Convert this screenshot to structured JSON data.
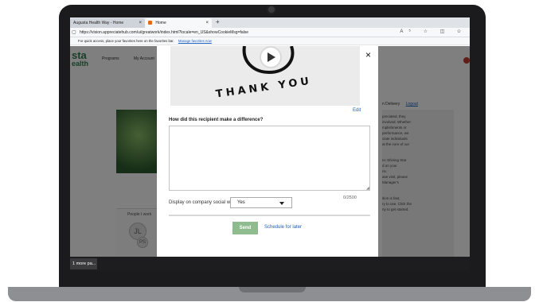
{
  "browser": {
    "tabs": [
      {
        "label": "Augusta Health Way - Home",
        "close": "×"
      },
      {
        "label": "Home",
        "close": "×"
      }
    ],
    "new_tab": "+",
    "url": "https://vision.appreciatehub.com/ui/greatwork/index.html?locale=en_US&showCookieMsg=false",
    "favorites_msg": "For quick access, place your favorites here on the favorites bar.",
    "favorites_link": "Manage favorites now",
    "tool_icons": [
      "read-aloud-icon",
      "favorite-star-icon",
      "split-screen-icon",
      "collections-icon"
    ],
    "tool_glyphs": "A⁵ ☆ ◫ ✩"
  },
  "page": {
    "brand_line1": "sta",
    "brand_line2": "ealth",
    "nav": [
      "Programs",
      "My Account"
    ],
    "right_link_prefix": "n Delivery",
    "right_link": "Logout",
    "right_text": [
      "preciated, they",
      "involved. Whether",
      "mplishments or",
      "performance, we",
      "ciate individuals",
      "at the core of our",
      "",
      "nc Shining Star",
      "d on your",
      "ns.",
      "ase visit, please",
      "Manager's",
      "",
      "ition is fast,",
      "ry to use. Click the",
      "ny to get started."
    ],
    "people_label": "People I work",
    "avatar_initials": "JL",
    "avatar2_initials": "PS"
  },
  "modal": {
    "close_label": "×",
    "video_text": "THANK YOU",
    "edit_label": "Edit",
    "question": "How did this recipient make a difference?",
    "textarea_value": "",
    "counter": "0/2500",
    "display_label": "Display on company social wall?",
    "display_value": "Yes",
    "send_label": "Send",
    "schedule_label": "Schedule for later"
  },
  "taskbar": {
    "item": "1 more pa..."
  },
  "colors": {
    "brand_green": "#2e7f4f",
    "send_button": "#8fbc8f",
    "link_blue": "#1f5fbf",
    "overlay": "rgba(0,0,0,0.5)"
  }
}
